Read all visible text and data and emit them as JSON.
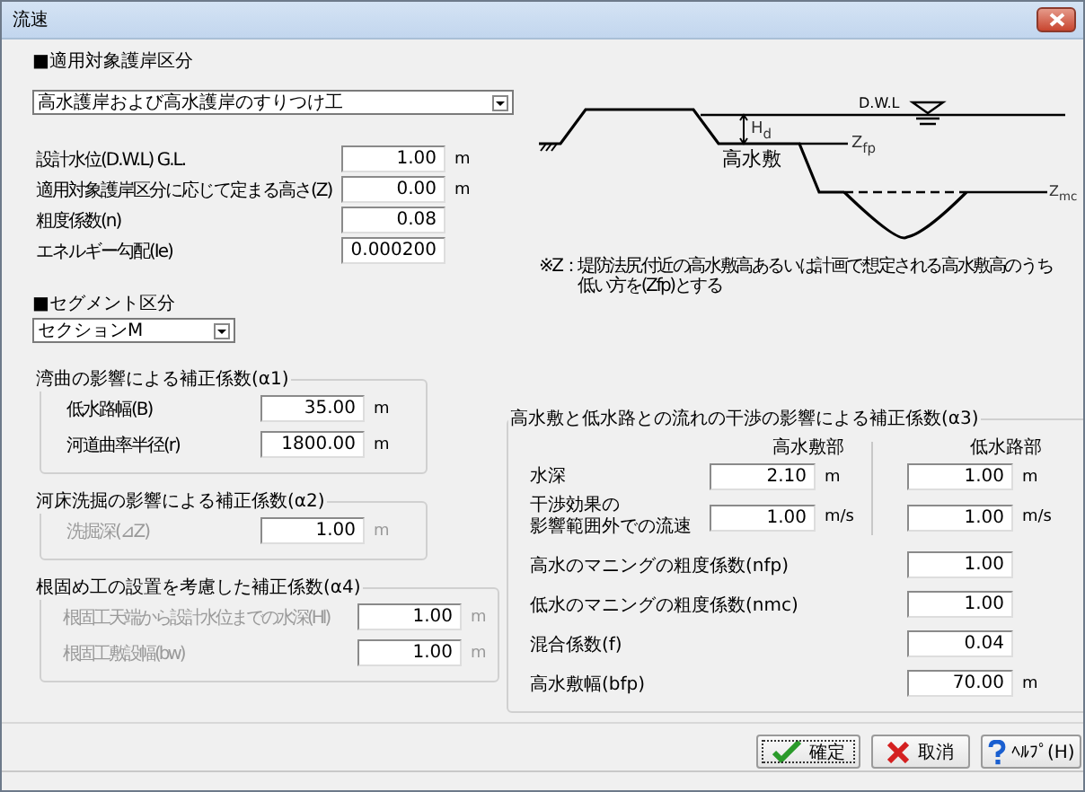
{
  "window": {
    "title": "流速"
  },
  "revetment": {
    "label": "■適用対象護岸区分",
    "dropdown": "高水護岸および高水護岸のすりつけ工"
  },
  "fields": [
    {
      "label": "設計水位(D.W.L) G.L.",
      "value": "1.00",
      "unit": "m"
    },
    {
      "label": "適用対象護岸区分に応じて定まる高さ(Z)",
      "value": "0.00",
      "unit": "m"
    },
    {
      "label": "粗度係数(n)",
      "value": "0.08"
    },
    {
      "label": "エネルギー勾配(Ie)",
      "value": "0.000200"
    }
  ],
  "diagram": {
    "dwl": "D.W.L",
    "hd": "H$_{d}$",
    "zfp": "Z$_{fp}$",
    "zmc": "Z$_{mc}$",
    "floodplain": "高水敷"
  },
  "note": {
    "mark": "※Z：",
    "lines": [
      "堤防法尻付近の高水敷高あるいは計画で想定される高水敷高のうち",
      "低い方を(Zfp)とする"
    ]
  },
  "segment": {
    "label": "■セグメント区分",
    "dropdown": "セクションM"
  },
  "groups": [
    {
      "title": "湾曲の影響による補正係数(α1)",
      "disabled": false,
      "fields": [
        {
          "label": "低水路幅(B)",
          "value": "35.00",
          "unit": "m"
        },
        {
          "label": "河道曲率半径(r)",
          "value": "1800.00",
          "unit": "m"
        }
      ]
    },
    {
      "title": "河床洗掘の影響による補正係数(α2)",
      "disabled": true,
      "fields": [
        {
          "label": "洗掘深(⊿Z)",
          "value": "1.00",
          "unit": "m"
        }
      ]
    },
    {
      "title": "根固め工の設置を考慮した補正係数(α4)",
      "disabled": true,
      "fields": [
        {
          "label": "根固工天端から設計水位までの水深(Hl)",
          "value": "1.00",
          "unit": "m"
        },
        {
          "label": "根固工敷設幅(bw)",
          "value": "1.00",
          "unit": "m"
        }
      ]
    }
  ],
  "alpha3": {
    "title": "高水敷と低水路との流れの干渉の影響による補正係数(α3)",
    "columns": [
      "高水敷部",
      "低水路部"
    ],
    "paired_rows": [
      {
        "label_lines": [
          "水深"
        ],
        "cells": [
          {
            "value": "2.10",
            "unit": "m"
          },
          {
            "value": "1.00",
            "unit": "m"
          }
        ]
      },
      {
        "label_lines": [
          "干渉効果の",
          "影響範囲外での流速"
        ],
        "cells": [
          {
            "value": "1.00",
            "unit": "m/s"
          },
          {
            "value": "1.00",
            "unit": "m/s"
          }
        ]
      }
    ],
    "rows": [
      {
        "label": "高水のマニングの粗度係数(nfp)",
        "value": "1.00"
      },
      {
        "label": "低水のマニングの粗度係数(nmc)",
        "value": "1.00"
      },
      {
        "label": "混合係数(f)",
        "value": "0.04"
      },
      {
        "label": "高水敷幅(bfp)",
        "value": "70.00",
        "unit": "m"
      }
    ]
  },
  "buttons": [
    {
      "label": "確定",
      "kind": "ok"
    },
    {
      "label": "取消",
      "kind": "cancel"
    },
    {
      "label": "ﾍﾙﾌﾟ(H)",
      "kind": "help"
    }
  ]
}
